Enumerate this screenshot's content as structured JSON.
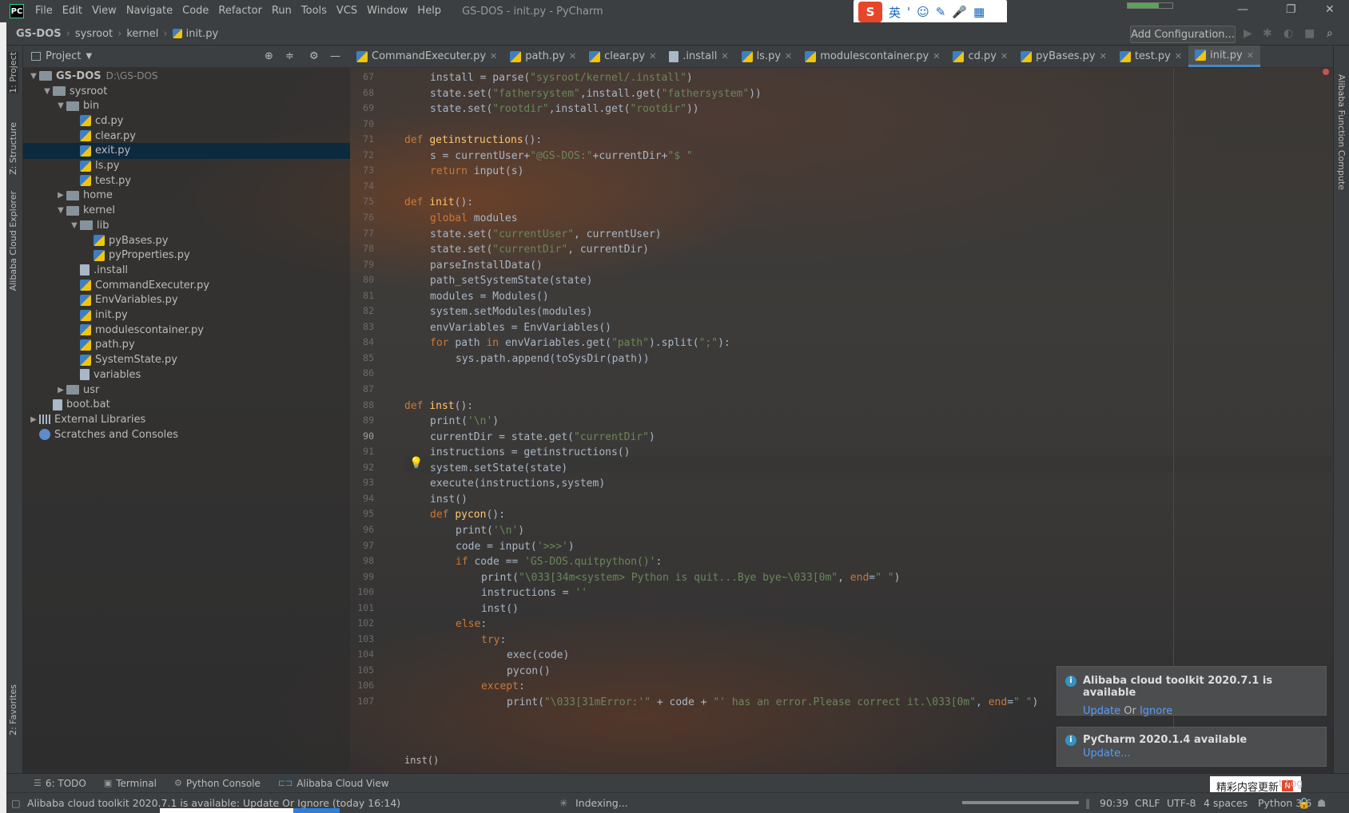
{
  "window": {
    "title": "GS-DOS - init.py - PyCharm",
    "logo": "PC"
  },
  "menu": [
    "File",
    "Edit",
    "View",
    "Navigate",
    "Code",
    "Refactor",
    "Run",
    "Tools",
    "VCS",
    "Window",
    "Help"
  ],
  "ime": {
    "label": "英",
    "items": [
      "'",
      "☺",
      "✎",
      "🎤",
      "▦"
    ]
  },
  "navbar": {
    "crumbs": [
      "GS-DOS",
      "sysroot",
      "kernel",
      "init.py"
    ],
    "add_config": "Add Configuration..."
  },
  "left_tabs": {
    "project": "1: Project",
    "structure": "Z: Structure",
    "alibaba": "Alibaba Cloud Explorer",
    "favorites": "2: Favorites"
  },
  "right_tabs": {
    "alibaba_fc": "Alibaba Function Compute"
  },
  "project": {
    "header": "Project",
    "root": {
      "name": "GS-DOS",
      "path": "D:\\GS-DOS"
    },
    "tree": [
      {
        "label": "sysroot",
        "kind": "folder",
        "depth": 1,
        "open": true
      },
      {
        "label": "bin",
        "kind": "folder",
        "depth": 2,
        "open": true
      },
      {
        "label": "cd.py",
        "kind": "py",
        "depth": 3
      },
      {
        "label": "clear.py",
        "kind": "py",
        "depth": 3
      },
      {
        "label": "exit.py",
        "kind": "py",
        "depth": 3,
        "selected": true
      },
      {
        "label": "ls.py",
        "kind": "py",
        "depth": 3
      },
      {
        "label": "test.py",
        "kind": "py",
        "depth": 3
      },
      {
        "label": "home",
        "kind": "folder",
        "depth": 2,
        "open": false
      },
      {
        "label": "kernel",
        "kind": "folder",
        "depth": 2,
        "open": true
      },
      {
        "label": "lib",
        "kind": "folder",
        "depth": 3,
        "open": true
      },
      {
        "label": "pyBases.py",
        "kind": "py",
        "depth": 4
      },
      {
        "label": "pyProperties.py",
        "kind": "py",
        "depth": 4
      },
      {
        "label": ".install",
        "kind": "txt",
        "depth": 3
      },
      {
        "label": "CommandExecuter.py",
        "kind": "py",
        "depth": 3
      },
      {
        "label": "EnvVariables.py",
        "kind": "py",
        "depth": 3
      },
      {
        "label": "init.py",
        "kind": "py",
        "depth": 3
      },
      {
        "label": "modulescontainer.py",
        "kind": "py",
        "depth": 3
      },
      {
        "label": "path.py",
        "kind": "py",
        "depth": 3
      },
      {
        "label": "SystemState.py",
        "kind": "py",
        "depth": 3
      },
      {
        "label": "variables",
        "kind": "txt",
        "depth": 3
      },
      {
        "label": "usr",
        "kind": "folder",
        "depth": 2,
        "open": false
      },
      {
        "label": "boot.bat",
        "kind": "txt",
        "depth": 1
      },
      {
        "label": "External Libraries",
        "kind": "lib",
        "depth": 0,
        "open": false
      },
      {
        "label": "Scratches and Consoles",
        "kind": "scratch",
        "depth": 0
      }
    ]
  },
  "tabs": [
    {
      "label": "CommandExecuter.py",
      "kind": "py"
    },
    {
      "label": "path.py",
      "kind": "py"
    },
    {
      "label": "clear.py",
      "kind": "py"
    },
    {
      "label": ".install",
      "kind": "txt"
    },
    {
      "label": "ls.py",
      "kind": "py"
    },
    {
      "label": "modulescontainer.py",
      "kind": "py"
    },
    {
      "label": "cd.py",
      "kind": "py"
    },
    {
      "label": "pyBases.py",
      "kind": "py"
    },
    {
      "label": "test.py",
      "kind": "py"
    },
    {
      "label": "init.py",
      "kind": "py",
      "active": true
    }
  ],
  "editor": {
    "current_line": "90",
    "lines": [
      {
        "n": "67",
        "indent": 1,
        "parts": [
          [
            "install = parse(",
            ""
          ],
          [
            "\"sysroot/kernel/.install\"",
            "st"
          ],
          [
            ")",
            ""
          ]
        ]
      },
      {
        "n": "68",
        "indent": 1,
        "parts": [
          [
            "state.set(",
            ""
          ],
          [
            "\"fathersystem\"",
            "st"
          ],
          [
            ",install.get(",
            ""
          ],
          [
            "\"fathersystem\"",
            "st"
          ],
          [
            "))",
            ""
          ]
        ]
      },
      {
        "n": "69",
        "indent": 1,
        "parts": [
          [
            "state.set(",
            ""
          ],
          [
            "\"rootdir\"",
            "st"
          ],
          [
            ",install.get(",
            ""
          ],
          [
            "\"rootdir\"",
            "st"
          ],
          [
            "))",
            ""
          ]
        ]
      },
      {
        "n": "70",
        "indent": 0,
        "parts": []
      },
      {
        "n": "71",
        "indent": 0,
        "parts": [
          [
            "def ",
            "kw"
          ],
          [
            "getinstructions",
            "fn"
          ],
          [
            "():",
            ""
          ]
        ]
      },
      {
        "n": "72",
        "indent": 1,
        "parts": [
          [
            "s = currentUser+",
            ""
          ],
          [
            "\"@GS-DOS:\"",
            "st"
          ],
          [
            "+currentDir+",
            ""
          ],
          [
            "\"$ \"",
            "st"
          ]
        ]
      },
      {
        "n": "73",
        "indent": 1,
        "parts": [
          [
            "return ",
            "kw"
          ],
          [
            "input(s)",
            ""
          ]
        ]
      },
      {
        "n": "74",
        "indent": 0,
        "parts": []
      },
      {
        "n": "75",
        "indent": 0,
        "parts": [
          [
            "def ",
            "kw"
          ],
          [
            "init",
            "fn"
          ],
          [
            "():",
            ""
          ]
        ]
      },
      {
        "n": "76",
        "indent": 1,
        "parts": [
          [
            "global ",
            "kw"
          ],
          [
            "modules",
            ""
          ]
        ]
      },
      {
        "n": "77",
        "indent": 1,
        "parts": [
          [
            "state.set(",
            ""
          ],
          [
            "\"currentUser\"",
            "st"
          ],
          [
            ", currentUser)",
            ""
          ]
        ]
      },
      {
        "n": "78",
        "indent": 1,
        "parts": [
          [
            "state.set(",
            ""
          ],
          [
            "\"currentDir\"",
            "st"
          ],
          [
            ", currentDir)",
            ""
          ]
        ]
      },
      {
        "n": "79",
        "indent": 1,
        "parts": [
          [
            "parseInstallData()",
            ""
          ]
        ]
      },
      {
        "n": "80",
        "indent": 1,
        "parts": [
          [
            "path_setSystemState(state)",
            ""
          ]
        ]
      },
      {
        "n": "81",
        "indent": 1,
        "parts": [
          [
            "modules = Modules()",
            ""
          ]
        ]
      },
      {
        "n": "82",
        "indent": 1,
        "parts": [
          [
            "system.setModules(modules)",
            ""
          ]
        ]
      },
      {
        "n": "83",
        "indent": 1,
        "parts": [
          [
            "envVariables = EnvVariables()",
            ""
          ]
        ]
      },
      {
        "n": "84",
        "indent": 1,
        "parts": [
          [
            "for ",
            "kw"
          ],
          [
            "path ",
            ""
          ],
          [
            "in ",
            "kw"
          ],
          [
            "envVariables.get(",
            ""
          ],
          [
            "\"path\"",
            "st"
          ],
          [
            ").split(",
            ""
          ],
          [
            "\";\"",
            "st"
          ],
          [
            "):",
            ""
          ]
        ]
      },
      {
        "n": "85",
        "indent": 2,
        "parts": [
          [
            "sys.path.append(toSysDir(path))",
            ""
          ]
        ]
      },
      {
        "n": "86",
        "indent": 0,
        "parts": []
      },
      {
        "n": "87",
        "indent": 0,
        "parts": []
      },
      {
        "n": "88",
        "indent": 0,
        "parts": [
          [
            "def ",
            "kw"
          ],
          [
            "inst",
            "fn"
          ],
          [
            "():",
            ""
          ]
        ]
      },
      {
        "n": "89",
        "indent": 1,
        "parts": [
          [
            "print(",
            ""
          ],
          [
            "'\\n'",
            "st"
          ],
          [
            ")",
            ""
          ]
        ]
      },
      {
        "n": "90",
        "indent": 1,
        "parts": [
          [
            "currentDir = state.get(",
            ""
          ],
          [
            "\"currentDir\"",
            "st"
          ],
          [
            ")",
            ""
          ]
        ]
      },
      {
        "n": "91",
        "indent": 1,
        "parts": [
          [
            "instructions = getinstructions()",
            ""
          ]
        ]
      },
      {
        "n": "92",
        "indent": 1,
        "parts": [
          [
            "system.setState(state)",
            ""
          ]
        ]
      },
      {
        "n": "93",
        "indent": 1,
        "parts": [
          [
            "execute(instructions,system)",
            ""
          ]
        ]
      },
      {
        "n": "94",
        "indent": 1,
        "parts": [
          [
            "inst()",
            ""
          ]
        ]
      },
      {
        "n": "95",
        "indent": 1,
        "parts": [
          [
            "def ",
            "kw"
          ],
          [
            "pycon",
            "fn"
          ],
          [
            "():",
            ""
          ]
        ]
      },
      {
        "n": "96",
        "indent": 2,
        "parts": [
          [
            "print(",
            ""
          ],
          [
            "'\\n'",
            "st"
          ],
          [
            ")",
            ""
          ]
        ]
      },
      {
        "n": "97",
        "indent": 2,
        "parts": [
          [
            "code = input(",
            ""
          ],
          [
            "'>>>'",
            "st"
          ],
          [
            ")",
            ""
          ]
        ]
      },
      {
        "n": "98",
        "indent": 2,
        "parts": [
          [
            "if ",
            "kw"
          ],
          [
            "code == ",
            ""
          ],
          [
            "'GS-DOS.quitpython()'",
            "st"
          ],
          [
            ":",
            ""
          ]
        ]
      },
      {
        "n": "99",
        "indent": 3,
        "parts": [
          [
            "print(",
            ""
          ],
          [
            "\"\\033[34m<system> Python is quit...Bye bye~\\033[0m\"",
            "st"
          ],
          [
            ", ",
            ""
          ],
          [
            "end",
            "kw"
          ],
          [
            "=",
            ""
          ],
          [
            "\" \"",
            "st"
          ],
          [
            ")",
            ""
          ]
        ]
      },
      {
        "n": "100",
        "indent": 3,
        "parts": [
          [
            "instructions = ",
            ""
          ],
          [
            "''",
            "st"
          ]
        ]
      },
      {
        "n": "101",
        "indent": 3,
        "parts": [
          [
            "inst()",
            ""
          ]
        ]
      },
      {
        "n": "102",
        "indent": 2,
        "parts": [
          [
            "else",
            "kw"
          ],
          [
            ":",
            ""
          ]
        ]
      },
      {
        "n": "103",
        "indent": 3,
        "parts": [
          [
            "try",
            "kw"
          ],
          [
            ":",
            ""
          ]
        ]
      },
      {
        "n": "104",
        "indent": 4,
        "parts": [
          [
            "exec(code)",
            ""
          ]
        ]
      },
      {
        "n": "105",
        "indent": 4,
        "parts": [
          [
            "pycon()",
            ""
          ]
        ]
      },
      {
        "n": "106",
        "indent": 3,
        "parts": [
          [
            "except",
            "kw"
          ],
          [
            ":",
            ""
          ]
        ]
      },
      {
        "n": "107",
        "indent": 4,
        "parts": [
          [
            "print(",
            ""
          ],
          [
            "\"\\033[31mError:'\"",
            "st"
          ],
          [
            " + code + ",
            ""
          ],
          [
            "\"' has an error.Please correct it.\\033[0m\"",
            "st"
          ],
          [
            ", ",
            ""
          ],
          [
            "end",
            "kw"
          ],
          [
            "=",
            ""
          ],
          [
            "\" \"",
            "st"
          ],
          [
            ")",
            ""
          ]
        ]
      }
    ],
    "context": "inst()"
  },
  "notifications": [
    {
      "title": "Alibaba cloud toolkit 2020.7.1 is available",
      "action1": "Update",
      "sep": "Or",
      "action2": "Ignore"
    },
    {
      "title": "PyCharm 2020.1.4 available",
      "action1": "Update..."
    }
  ],
  "toolwindows": [
    "6: TODO",
    "Terminal",
    "Python Console",
    "Alibaba Cloud View"
  ],
  "status": {
    "message": "Alibaba cloud toolkit 2020.7.1 is available: Update Or Ignore (today 16:14)",
    "indexing": "Indexing...",
    "position": "90:39",
    "line_sep": "CRLF",
    "encoding": "UTF-8",
    "indent": "4 spaces",
    "interpreter": "Python 3.6",
    "event_log": "t Log"
  },
  "promo": {
    "text": "精彩内容更新",
    "badge": "N"
  }
}
